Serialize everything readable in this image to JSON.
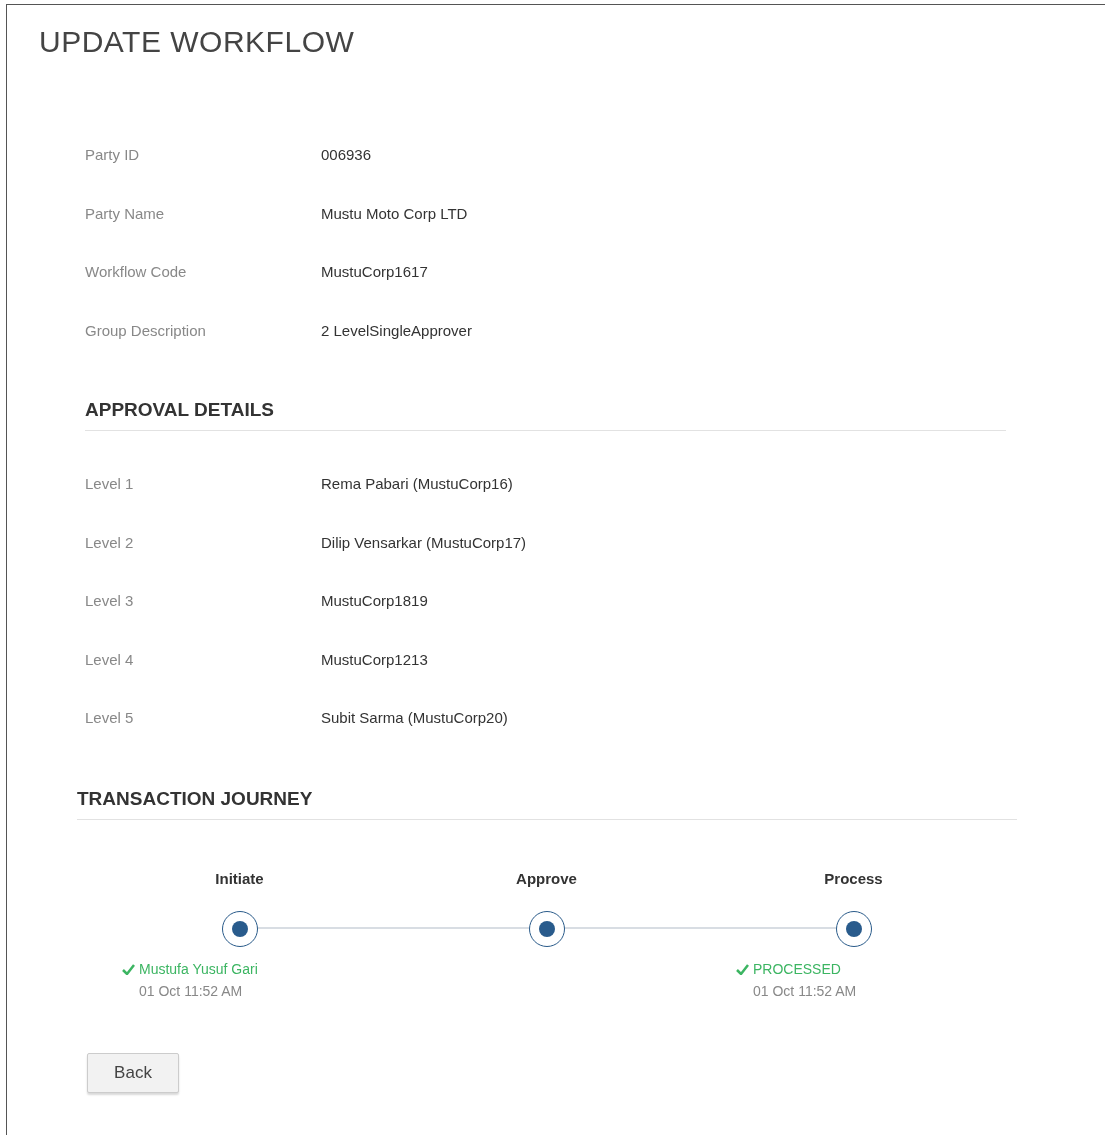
{
  "title": "UPDATE WORKFLOW",
  "details": [
    {
      "label": "Party ID",
      "value": "006936"
    },
    {
      "label": "Party Name",
      "value": "Mustu Moto Corp LTD"
    },
    {
      "label": "Workflow Code",
      "value": "MustuCorp1617"
    },
    {
      "label": "Group Description",
      "value": "2 LevelSingleApprover"
    }
  ],
  "approval_details": {
    "heading": "APPROVAL DETAILS",
    "levels": [
      {
        "label": "Level 1",
        "value": "Rema Pabari (MustuCorp16)"
      },
      {
        "label": "Level 2",
        "value": "Dilip Vensarkar (MustuCorp17)"
      },
      {
        "label": "Level 3",
        "value": "MustuCorp1819"
      },
      {
        "label": "Level 4",
        "value": "MustuCorp1213"
      },
      {
        "label": "Level 5",
        "value": "Subit Sarma (MustuCorp20)"
      }
    ]
  },
  "transaction_journey": {
    "heading": "TRANSACTION JOURNEY",
    "steps": [
      {
        "label": "Initiate",
        "event": {
          "text": "Mustufa Yusuf Gari",
          "time": "01 Oct 11:52 AM"
        }
      },
      {
        "label": "Approve"
      },
      {
        "label": "Process",
        "event": {
          "text": "PROCESSED",
          "time": "01 Oct 11:52 AM"
        }
      }
    ]
  },
  "buttons": [
    "Back"
  ]
}
